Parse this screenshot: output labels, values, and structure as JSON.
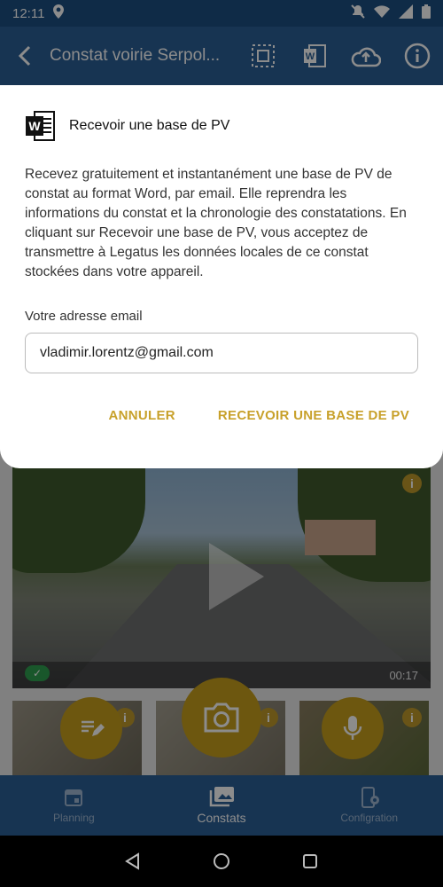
{
  "status_bar": {
    "time": "12:11"
  },
  "app_bar": {
    "title": "Constat voirie Serpol..."
  },
  "video": {
    "duration": "00:17"
  },
  "dialog": {
    "title": "Recevoir une base de PV",
    "body": "Recevez gratuitement et instantanément une base de PV de constat au format Word, par email. Elle reprendra les informations du constat et la chronologie des constatations. En cliquant sur Recevoir une base de PV, vous acceptez de transmettre à Legatus les données locales de ce constat stockées dans votre appareil.",
    "email_label": "Votre adresse email",
    "email_value": "vladimir.lorentz@gmail.com",
    "cancel_label": "ANNULER",
    "confirm_label": "RECEVOIR UNE BASE DE PV"
  },
  "bottom_nav": [
    {
      "label": "Planning"
    },
    {
      "label": "Constats"
    },
    {
      "label": "Configration"
    }
  ],
  "colors": {
    "app_bar": "#2b5f96",
    "accent": "#c8a12b"
  }
}
